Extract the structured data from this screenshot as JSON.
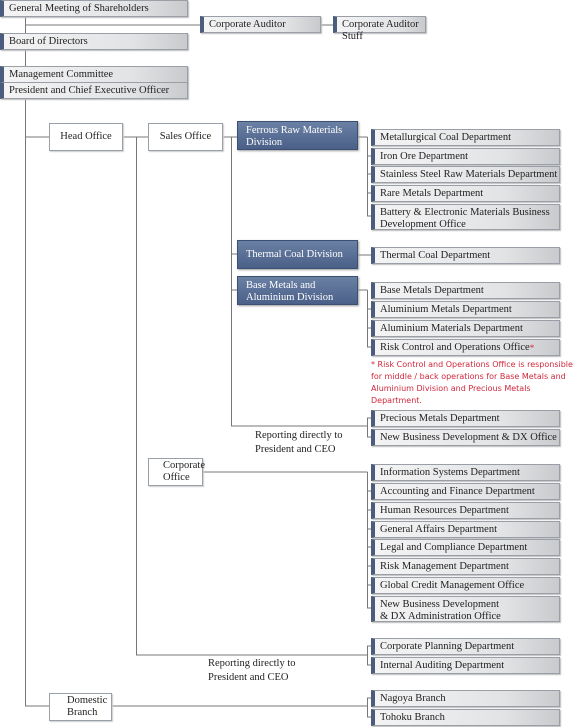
{
  "top": {
    "shareholders": "General Meeting of Shareholders",
    "auditor": "Corporate Auditor",
    "auditor_stuff": "Corporate Auditor Stuff",
    "board": "Board of Directors",
    "mgmt": "Management Committee",
    "president": "President and Chief Executive Officer"
  },
  "offices": {
    "head": "Head Office",
    "sales": "Sales Office",
    "corporate": "Corporate Office",
    "domestic": "Domestic Branch"
  },
  "divisions": {
    "ferrous": "Ferrous Raw Materials Division",
    "thermal": "Thermal Coal Division",
    "base": "Base Metals and Aluminium Division"
  },
  "ferrous_depts": [
    "Metallurgical Coal Department",
    "Iron Ore Department",
    "Stainless Steel Raw Materials Department",
    "Rare Metals Department",
    "Battery & Electronic Materials Business Development Office"
  ],
  "thermal_depts": [
    "Thermal Coal Department"
  ],
  "base_depts": [
    "Base Metals Department",
    "Aluminium Metals Department",
    "Aluminium Materials Department",
    "Risk Control and Operations Office"
  ],
  "asterisk": "*",
  "note": "* Risk Control and Operations Office is responsible for middle / back operations for Base Metals and Aluminium Division and Precious Metals Department.",
  "sales_direct": [
    "Precious Metals Department",
    "New Business Development & DX Office"
  ],
  "reporting_label": "Reporting directly to President and CEO",
  "corporate_depts": [
    "Information Systems Department",
    "Accounting and Finance Department",
    "Human Resources Department",
    "General Affairs Department",
    "Legal and Compliance Department",
    "Risk Management Department",
    "Global Credit Management Office",
    "New Business Development & DX Administration Office"
  ],
  "corporate_direct": [
    "Corporate Planning Department",
    "Internal Auditing Department"
  ],
  "branches": [
    "Nagoya Branch",
    "Tohoku Branch"
  ],
  "colors": {
    "division": "#4b6088",
    "accent_bar": "#4c5c7c",
    "note": "#d0283c"
  }
}
